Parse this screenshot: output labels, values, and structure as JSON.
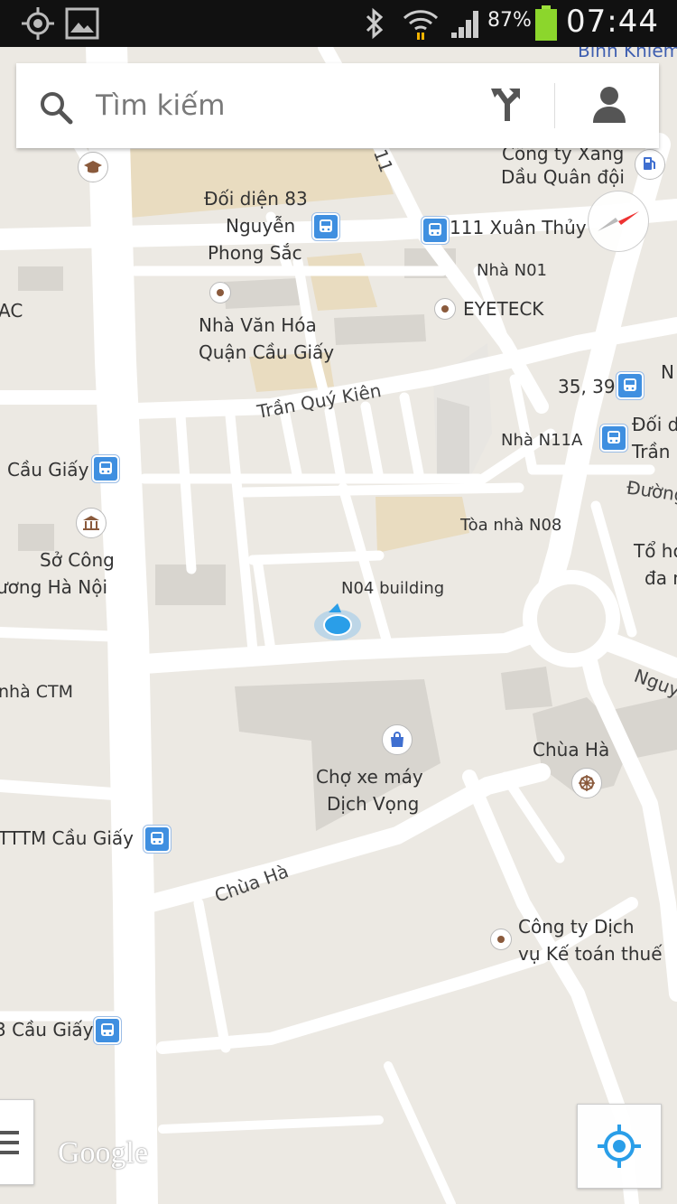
{
  "status": {
    "battery": "87%",
    "time": "07:44"
  },
  "search": {
    "placeholder": "Tìm kiếm"
  },
  "labels": {
    "binh_khiem": "Bình Khiêm",
    "cong_ty_xang_1": "Công ty Xăng",
    "cong_ty_xang_2": "Dầu Quân đội",
    "doi_dien_1": "Đối diện 83",
    "doi_dien_2": "Nguyễn",
    "doi_dien_3": "Phong Sắc",
    "xuan_thuy": "111 Xuân Thủy",
    "nha_n01": "Nhà N01",
    "ac": "AC",
    "eyeteck": "EYETECK",
    "nha_van_hoa_1": "Nhà Văn Hóa",
    "nha_van_hoa_2": "Quận Cầu Giấy",
    "tran_quy_kien": "Trần Quý Kiên",
    "n39": "35, 39",
    "n_edge": "N",
    "doi_d_1": "Đối d",
    "doi_d_2": "Trần",
    "nha_n11a": "Nhà N11A",
    "cau_giay_stop": "Cầu Giấy",
    "duong": "Đường",
    "so_cong_1": "Sở Công",
    "so_cong_2": "ương Hà Nội",
    "toa_nha_n08": "Tòa nhà N08",
    "to_hop_1": "Tổ hợ",
    "to_hop_2": "đa n",
    "n04_building": "N04 building",
    "nha_ctm": "nhà CTM",
    "nguy": "Nguy",
    "chua_ha_poi": "Chùa Hà",
    "cho_xe_may_1": "Chợ xe máy",
    "cho_xe_may_2": "Dịch Vọng",
    "tttm_cau_giay": "TTTM Cầu Giấy",
    "chua_ha_road": "Chùa Hà",
    "cong_ty_dich_vu_1": "Công ty Dịch",
    "cong_ty_dich_vu_2": "vụ Kế toán thuế",
    "cau_giay_3": "3 Cầu Giấy",
    "road_11": "11"
  },
  "logo": "Google",
  "colors": {
    "background": "#ece9e3",
    "road": "#ffffff",
    "building": "#d8d5cf",
    "highlight": "#e9dcc0",
    "transit": "#3f8fe0",
    "location": "#2a9ee8"
  }
}
